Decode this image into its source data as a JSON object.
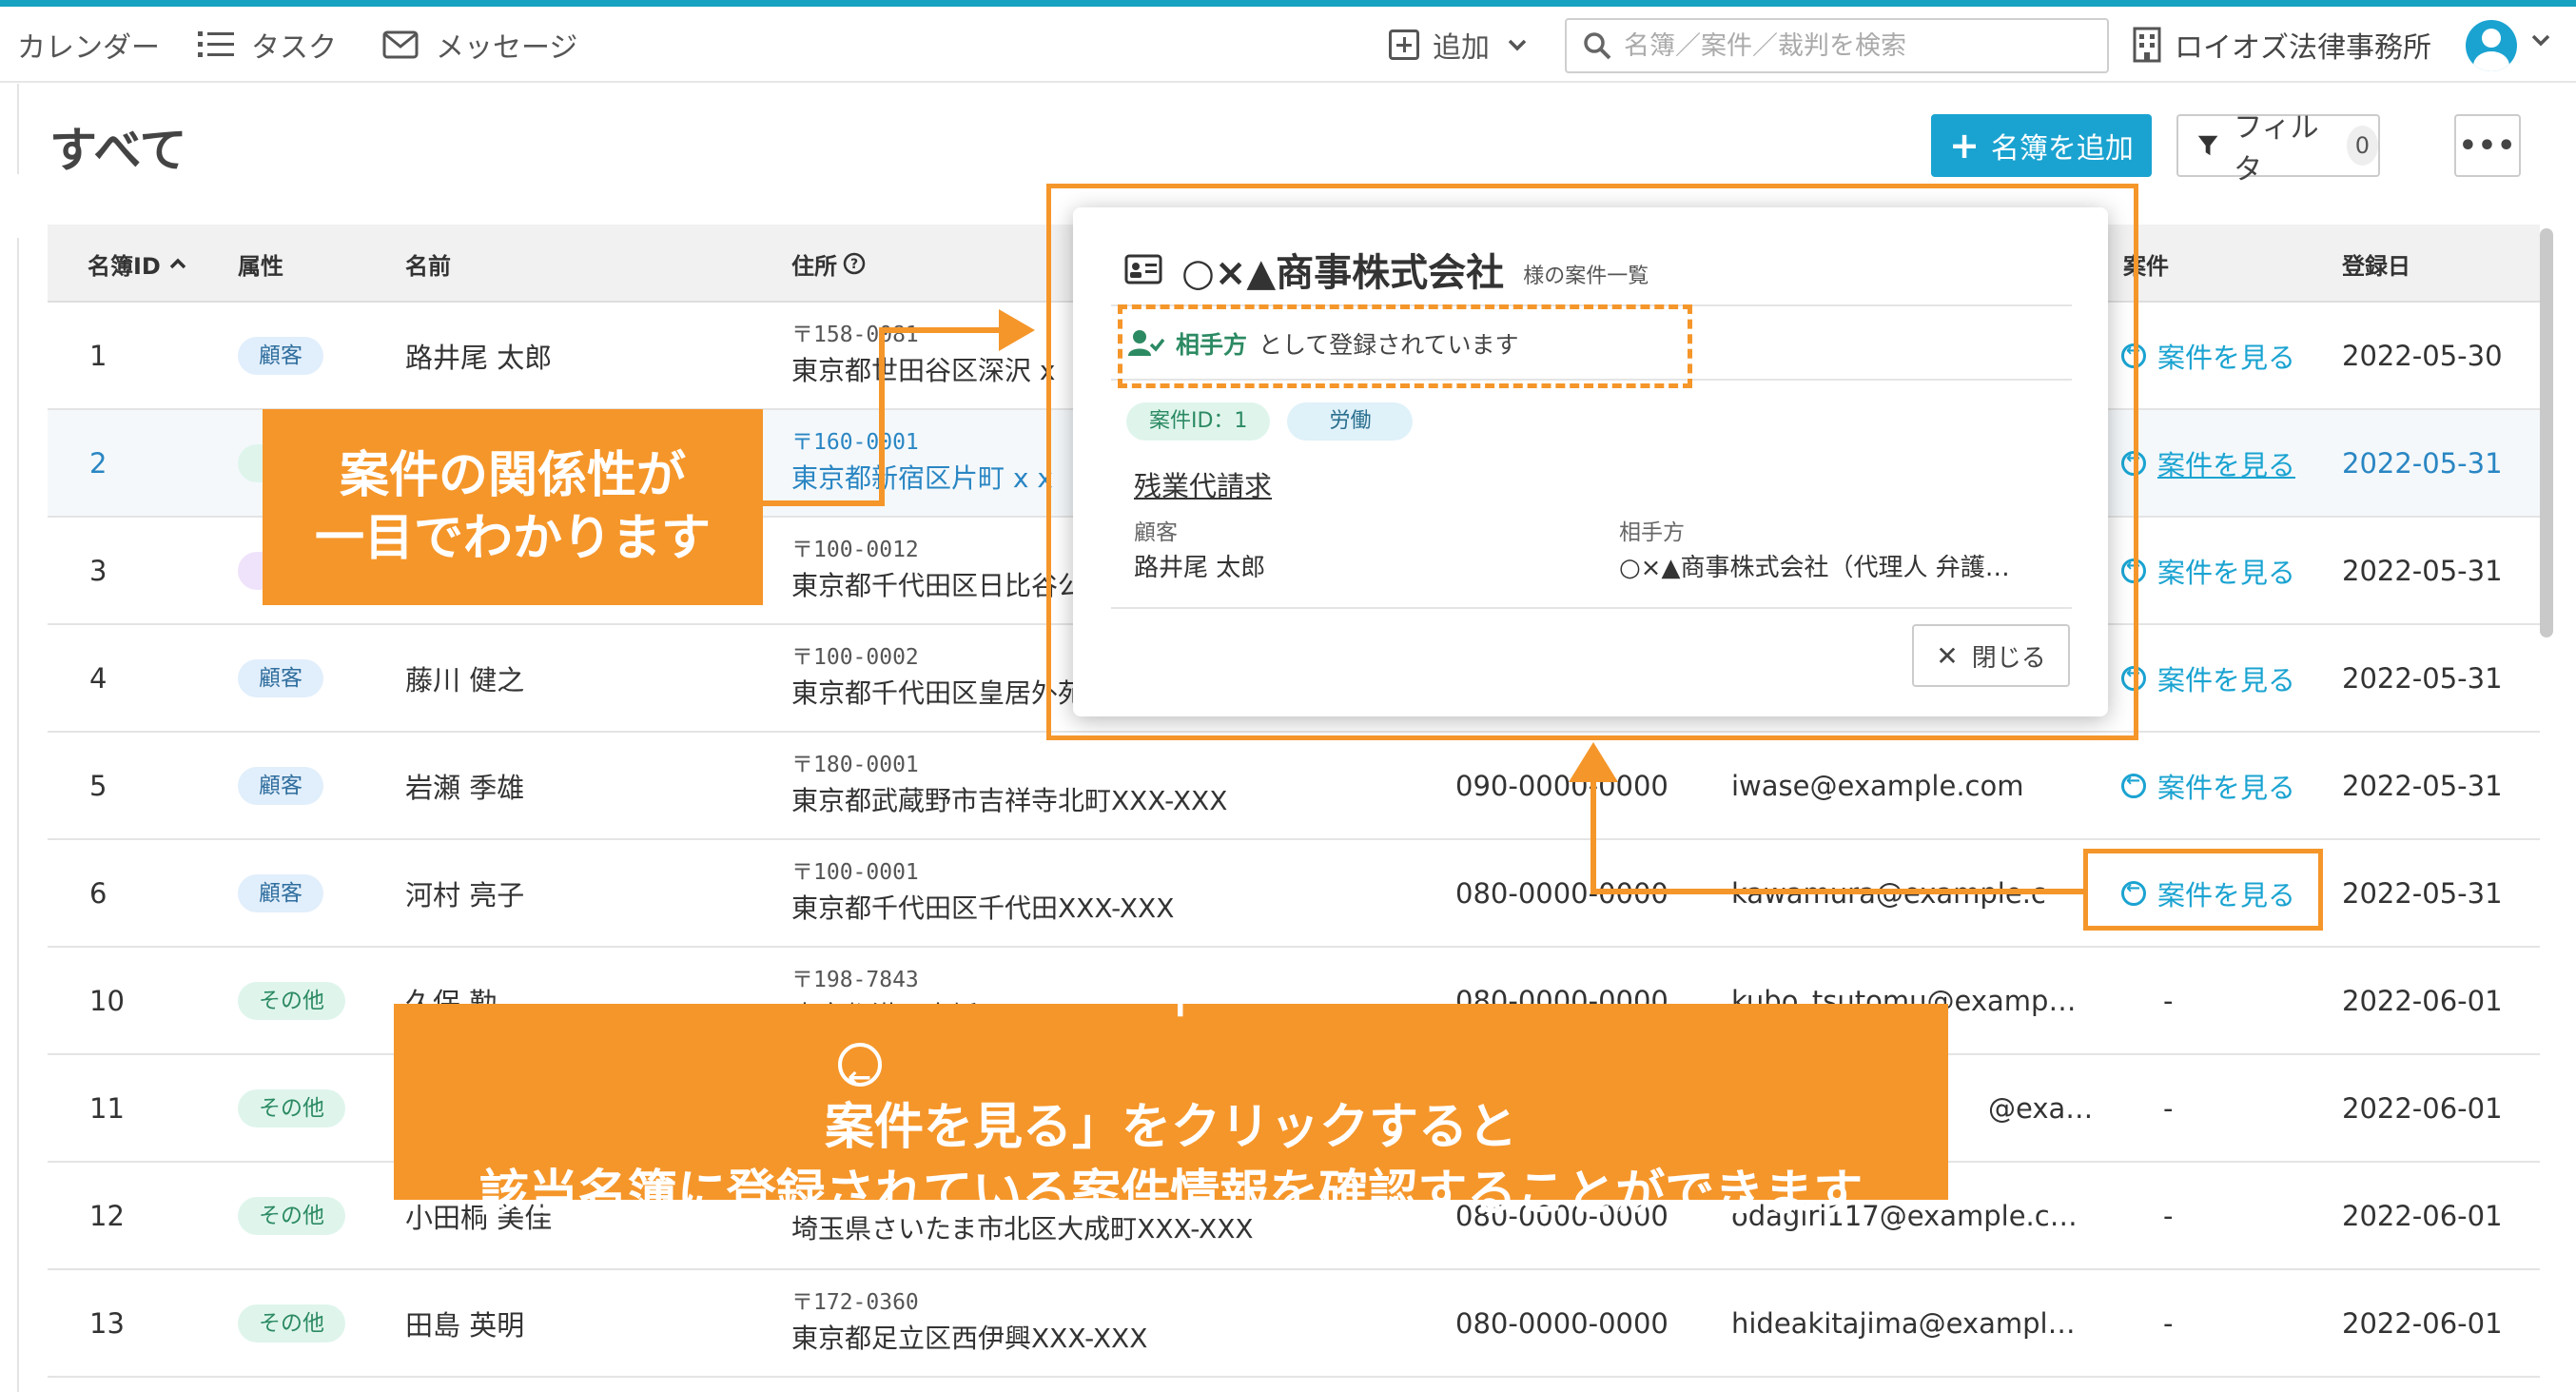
{
  "nav": {
    "calendar": "カレンダー",
    "tasks": "タスク",
    "messages": "メッセージ",
    "add": "追加",
    "search_placeholder": "名簿／案件／裁判を検索",
    "office": "ロイオズ法律事務所"
  },
  "page": {
    "title": "すべて",
    "add_button": "名簿を追加",
    "filter_button": "フィルタ",
    "filter_count": "0",
    "more_button": "•••"
  },
  "table": {
    "headers": {
      "id": "名簿ID",
      "attr": "属性",
      "name": "名前",
      "address": "住所",
      "case": "案件",
      "date": "登録日"
    },
    "rows": [
      {
        "id": "1",
        "attr": "顧客",
        "name": "路井尾 太郎",
        "zip": "〒158-0081",
        "street": "東京都世田谷区深沢 x",
        "phone": "",
        "email": "",
        "case": "案件を見る",
        "date": "2022-05-30"
      },
      {
        "id": "2",
        "attr": "",
        "name": "",
        "zip": "〒160-0001",
        "street": "東京都新宿区片町 x x",
        "phone": "",
        "email": "",
        "case": "案件を見る",
        "date": "2022-05-31"
      },
      {
        "id": "3",
        "attr": "",
        "name": "",
        "zip": "〒100-0012",
        "street": "東京都千代田区日比谷公",
        "phone": "",
        "email": "",
        "case": "案件を見る",
        "date": "2022-05-31"
      },
      {
        "id": "4",
        "attr": "顧客",
        "name": "藤川 健之",
        "zip": "〒100-0002",
        "street": "東京都千代田区皇居外苑",
        "phone": "",
        "email": "",
        "case": "案件を見る",
        "date": "2022-05-31"
      },
      {
        "id": "5",
        "attr": "顧客",
        "name": "岩瀬 季雄",
        "zip": "〒180-0001",
        "street": "東京都武蔵野市吉祥寺北町XXX-XXX",
        "phone": "090-0000-0000",
        "email": "iwase@example.com",
        "case": "案件を見る",
        "date": "2022-05-31"
      },
      {
        "id": "6",
        "attr": "顧客",
        "name": "河村 亮子",
        "zip": "〒100-0001",
        "street": "東京都千代田区千代田XXX-XXX",
        "phone": "080-0000-0000",
        "email": "kawamura@example.c",
        "case": "案件を見る",
        "date": "2022-05-31"
      },
      {
        "id": "10",
        "attr": "その他",
        "name": "久保 勤",
        "zip": "〒198-7843",
        "street": "東京都港区赤坂XXX-XXX",
        "phone": "080-0000-0000",
        "email": "kubo_tsutomu@examp…",
        "case": "-",
        "date": "2022-06-01"
      },
      {
        "id": "11",
        "attr": "その他",
        "name": "",
        "zip": "",
        "street": "",
        "phone": "",
        "email": "@exa…",
        "case": "-",
        "date": "2022-06-01"
      },
      {
        "id": "12",
        "attr": "その他",
        "name": "小田桐 美佳",
        "zip": "",
        "street": "埼玉県さいたま市北区大成町XXX-XXX",
        "phone": "080-0000-0000",
        "email": "odagiri117@example.c…",
        "case": "-",
        "date": "2022-06-01"
      },
      {
        "id": "13",
        "attr": "その他",
        "name": "田島 英明",
        "zip": "〒172-0360",
        "street": "東京都足立区西伊興XXX-XXX",
        "phone": "080-0000-0000",
        "email": "hideakitajima@exampl…",
        "case": "-",
        "date": "2022-06-01"
      }
    ]
  },
  "popup": {
    "company": "○×▲商事株式会社",
    "subtitle": "様の案件一覧",
    "role": "相手方",
    "role_suffix": "として登録されています",
    "case_id": "案件ID：1",
    "category": "労働",
    "case_title": "残業代請求",
    "client_label": "顧客",
    "client_value": "路井尾 太郎",
    "opponent_label": "相手方",
    "opponent_value": "○×▲商事株式会社（代理人 弁護…",
    "close": "閉じる"
  },
  "annotations": {
    "callout1_line1": "案件の関係性が",
    "callout1_line2": "一目でわかります",
    "callout2_prefix": "「",
    "callout2_line1": "案件を見る」をクリックすると",
    "callout2_line2": "該当名簿に登録されている案件情報を確認することができます"
  },
  "colors": {
    "accent": "#1aa3d1",
    "annotation": "#f5962a",
    "client_badge": "#e1eefb",
    "other_badge": "#dff5ec"
  }
}
